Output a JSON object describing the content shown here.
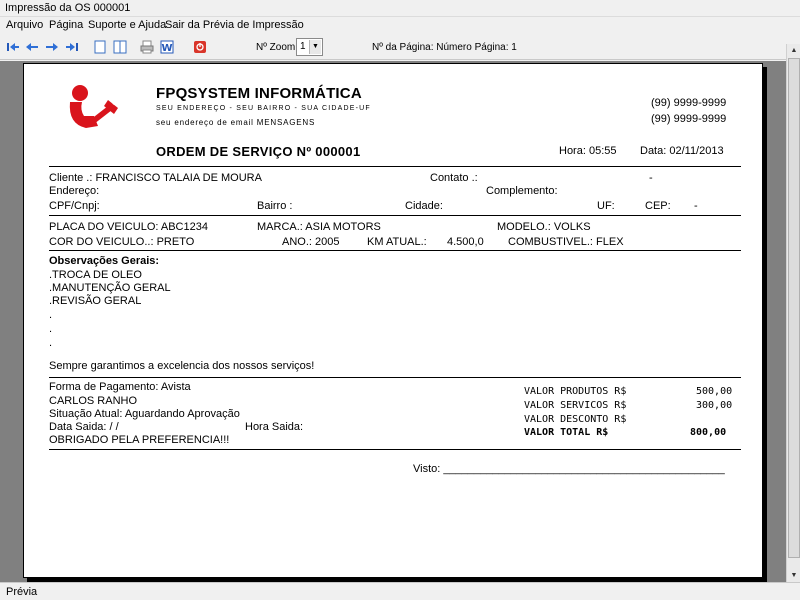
{
  "window": {
    "title": "Impressão da OS 000001"
  },
  "menu": [
    "Arquivo",
    "Página",
    "Suporte e Ajuda",
    "Sair da Prévia de Impressão"
  ],
  "toolbar": {
    "zoom_label": "Nº Zoom",
    "zoom_value": "1",
    "page_info": "Nº da Página: Número Página: 1"
  },
  "status": "Prévia",
  "report": {
    "company": "FPQSYSTEM INFORMÁTICA",
    "address": "SEU ENDEREÇO - SEU BAIRRO - SUA CIDADE-UF",
    "email": "seu endereço de email  MENSAGENS",
    "phone1": "(99) 9999-9999",
    "phone2": "(99) 9999-9999",
    "title": "ORDEM DE SERVIÇO Nº 000001",
    "hora": "Hora: 05:55",
    "data": "Data: 02/11/2013",
    "cliente": "Cliente     .: FRANCISCO TALAIA DE MOURA",
    "contato": "Contato .:",
    "contato_dash": "-",
    "endereco": "Endereço:",
    "complemento": "Complemento:",
    "cpf": "CPF/Cnpj:",
    "bairro": "Bairro :",
    "cidade": "Cidade:",
    "uf": "UF:",
    "cep": "CEP:",
    "cep_dash": "-",
    "placa": "PLACA DO VEICULO:  ABC1234",
    "marca": "MARCA.: ASIA MOTORS",
    "modelo": "MODELO.: VOLKS",
    "cor": "COR DO VEICULO..: PRETO",
    "ano": "ANO.: 2005",
    "km": "KM ATUAL.:",
    "km_value": "4.500,0",
    "combustivel": "COMBUSTIVEL.: FLEX",
    "obs_title": "Observações Gerais:",
    "obs_lines": [
      ".TROCA DE OLEO",
      ".MANUTENÇÃO GERAL",
      ".REVISÃO GERAL",
      ".",
      ".",
      "."
    ],
    "obs_footer": "Sempre garantimos a excelencia dos nossos serviços!",
    "pagamento": "Forma de Pagamento: Avista",
    "tecnico": " CARLOS RANHO",
    "situacao": "Situação Atual: Aguardando Aprovação",
    "data_saida": "Data Saida:   /  /",
    "hora_saida": "Hora Saida:",
    "obrigado": "OBRIGADO PELA PREFERENCIA!!!",
    "totals": [
      {
        "label": "VALOR PRODUTOS R$",
        "value": "500,00"
      },
      {
        "label": "VALOR SERVICOS R$",
        "value": "300,00"
      },
      {
        "label": "VALOR DESCONTO R$",
        "value": ""
      },
      {
        "label": "VALOR TOTAL    R$",
        "value": "800,00"
      }
    ],
    "visto": "Visto: ______________________________________________"
  }
}
